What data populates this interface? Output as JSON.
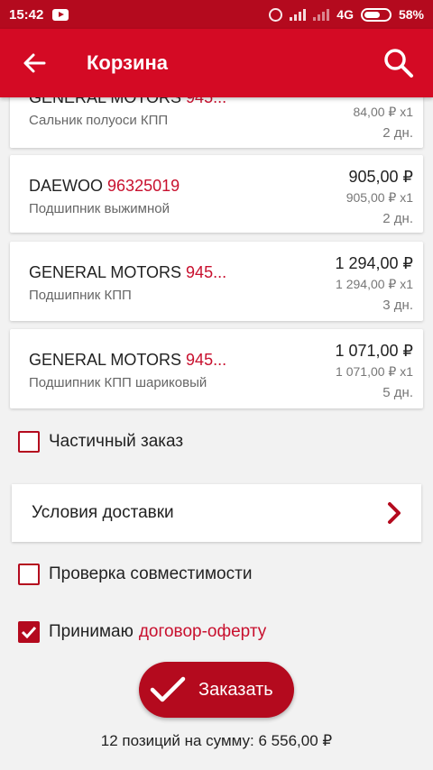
{
  "status_bar": {
    "time": "15:42",
    "network": "4G",
    "battery": "58%"
  },
  "toolbar": {
    "title": "Корзина",
    "back_icon": "arrow-back-icon",
    "search_icon": "search-icon"
  },
  "items": [
    {
      "brand": "GENERAL MOTORS",
      "code": "945...",
      "desc": "Сальник полуоси КПП",
      "price": "",
      "unit_price": "84,00 ₽ x1",
      "days": "2 дн."
    },
    {
      "brand": "DAEWOO",
      "code": "96325019",
      "desc": "Подшипник выжимной",
      "price": "905,00 ₽",
      "unit_price": "905,00 ₽ x1",
      "days": "2 дн."
    },
    {
      "brand": "GENERAL MOTORS",
      "code": "945...",
      "desc": "Подшипник КПП",
      "price": "1 294,00 ₽",
      "unit_price": "1 294,00 ₽ x1",
      "days": "3 дн."
    },
    {
      "brand": "GENERAL MOTORS",
      "code": "945...",
      "desc": "Подшипник КПП шариковый",
      "price": "1 071,00 ₽",
      "unit_price": "1 071,00 ₽ x1",
      "days": "5 дн."
    }
  ],
  "options": {
    "partial_order": {
      "label": "Частичный заказ",
      "checked": false
    },
    "delivery_label": "Условия доставки",
    "compatibility": {
      "label": "Проверка совместимости",
      "checked": false
    },
    "accept": {
      "label": "Принимаю",
      "link": "договор-оферту",
      "checked": true
    }
  },
  "order_button": {
    "label": "Заказать"
  },
  "summary": "12 позиций на сумму: 6 556,00 ₽",
  "colors": {
    "primary": "#d40a24",
    "dark_primary": "#b40a1e",
    "accent_text": "#c8102e"
  }
}
